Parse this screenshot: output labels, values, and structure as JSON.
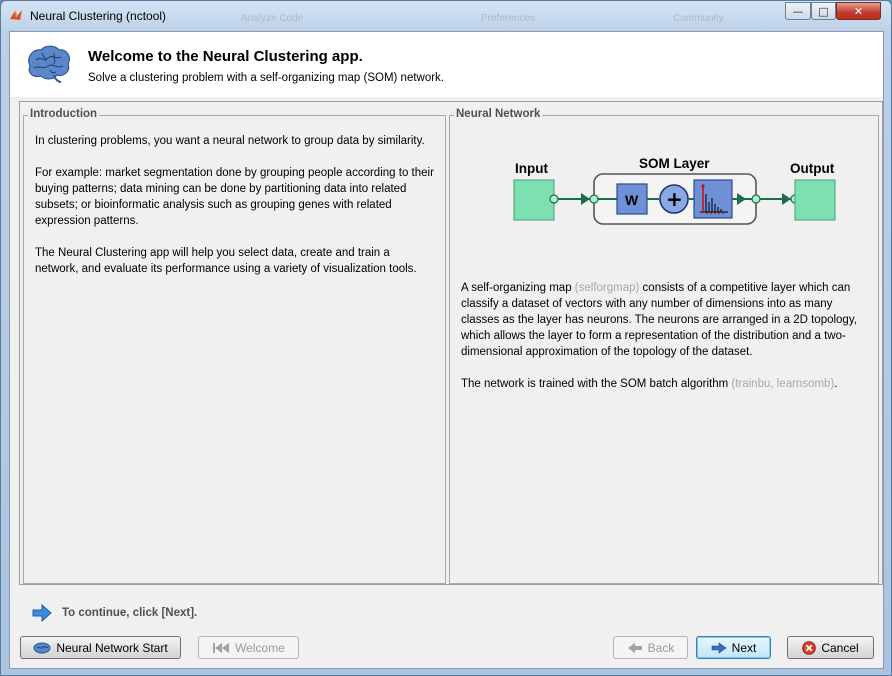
{
  "window": {
    "title": "Neural Clustering (nctool)",
    "ghost_tabs": [
      "Analyze Code",
      "Preferences",
      "Community"
    ],
    "controls": {
      "minimize": "—",
      "maximize": "□",
      "close": "✕"
    }
  },
  "header": {
    "title": "Welcome to the Neural Clustering app.",
    "subtitle": "Solve a clustering problem with a self-organizing map (SOM) network."
  },
  "introduction": {
    "title": "Introduction",
    "paragraphs": [
      "In clustering problems, you want a neural network to group data by similarity.",
      "For example: market segmentation done by grouping people according to their buying patterns; data mining can be done by partitioning data into related subsets; or bioinformatic analysis such as grouping genes with related expression patterns.",
      "The Neural Clustering app will help you select data, create and train a network, and evaluate its performance using a variety of visualization tools."
    ]
  },
  "network": {
    "title": "Neural Network",
    "diagram": {
      "input_label": "Input",
      "layer_label": "SOM Layer",
      "output_label": "Output",
      "weight_label": "W",
      "sum_symbol": "+"
    },
    "p1_a": "A self-organizing map ",
    "p1_link": "(selforgmap)",
    "p1_b": " consists of a competitive layer which can classify a dataset of vectors with any number of dimensions into as many classes as the layer has neurons. The neurons are arranged in a 2D topology, which allows the layer to form a representation of the distribution and a two-dimensional approximation of the topology of the dataset.",
    "p2_a": "The network is trained with the SOM batch algorithm ",
    "p2_link": "(trainbu, learnsomb)",
    "p2_b": "."
  },
  "footer": {
    "continue_text": "To continue, click [Next].",
    "buttons": {
      "start": "Neural Network Start",
      "welcome": "Welcome",
      "back": "Back",
      "next": "Next",
      "cancel": "Cancel"
    }
  },
  "colors": {
    "input_box": "#7de0b0",
    "weight_box": "#6f8fd6",
    "accent_blue": "#2f6fc0",
    "cancel_red": "#d9442b"
  }
}
